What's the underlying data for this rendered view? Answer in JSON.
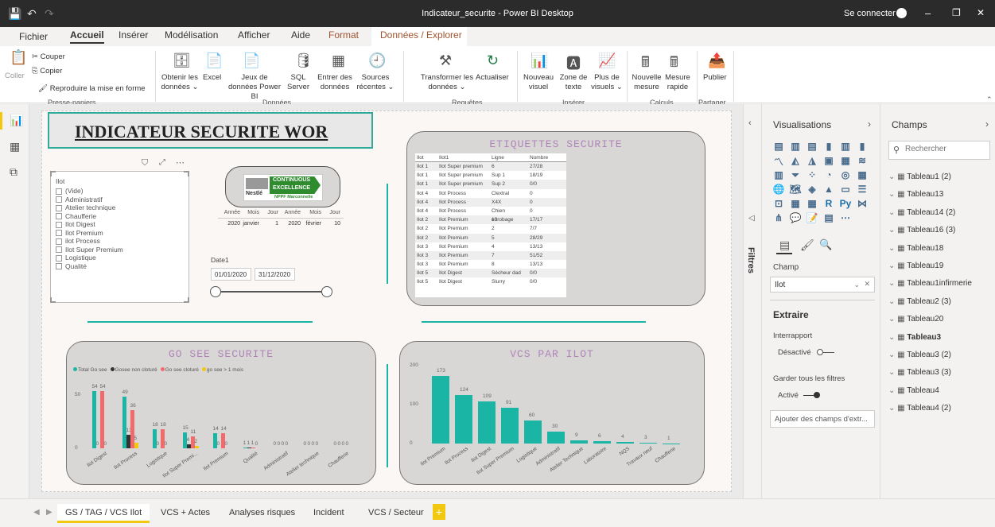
{
  "titlebar": {
    "title": "Indicateur_securite - Power BI Desktop",
    "signin": "Se connecter",
    "min": "–",
    "max": "❐",
    "close": "✕"
  },
  "menu": {
    "items": [
      "Fichier",
      "Accueil",
      "Insérer",
      "Modélisation",
      "Afficher",
      "Aide",
      "Format",
      "Données / Explorer"
    ]
  },
  "ribbon": {
    "coller": "Coller",
    "couper": "Couper",
    "copier": "Copier",
    "reproduire": "Reproduire la mise en forme",
    "presse_papiers": "Presse-papiers",
    "obtenir": "Obtenir les données ⌄",
    "excel": "Excel",
    "jeux": "Jeux de données Power BI",
    "sql": "SQL Server",
    "entrer": "Entrer des données",
    "sources": "Sources récentes ⌄",
    "donnees": "Données",
    "transformer": "Transformer les données ⌄",
    "actualiser": "Actualiser",
    "requetes": "Requêtes",
    "nouveau": "Nouveau visuel",
    "zone": "Zone de texte",
    "plus": "Plus de visuels ⌄",
    "inserer": "Insérer",
    "nouvelle_mesure": "Nouvelle mesure",
    "mesure_rapide": "Mesure rapide",
    "calculs": "Calculs",
    "publier": "Publier",
    "partager": "Partager"
  },
  "report": {
    "title": "INDICATEUR SECURITE WOR",
    "slicer": {
      "header": "Ilot",
      "items": [
        "(Vide)",
        "Administratif",
        "Atelier technique",
        "Chaufferie",
        "Ilot Digest",
        "Ilot Premium",
        "ilot Process",
        "Ilot Super Premium",
        "Logistique",
        "Qualité"
      ]
    },
    "logo": {
      "line1": "CONTINUOUS",
      "line2": "EXCELLENCE",
      "line3": "NPPF Marconnelle",
      "brand": "Nestlé"
    },
    "dates": {
      "headers": [
        "Année",
        "Mois",
        "Jour",
        "Année",
        "Mois",
        "Jour"
      ],
      "values": [
        "2020",
        "janvier",
        "1",
        "2020",
        "février",
        "10"
      ]
    },
    "date1": {
      "label": "Date1",
      "from": "01/01/2020",
      "to": "31/12/2020"
    },
    "etiquettes": {
      "title": "ETIQUETTES SECURITE",
      "headers": [
        "Ilot",
        "Ilot1",
        "Ligne",
        "Nombre"
      ],
      "rows": [
        [
          "Ilot 1",
          "Ilot Super premium",
          "6",
          "27/28"
        ],
        [
          "Ilot 1",
          "Ilot Super premium",
          "Sup 1",
          "18/19"
        ],
        [
          "Ilot 1",
          "Ilot Super premium",
          "Sup 2",
          "0/0"
        ],
        [
          "Ilot 4",
          "Ilot Process",
          "Clextral",
          "0"
        ],
        [
          "Ilot 4",
          "Ilot Process",
          "X4X",
          "0"
        ],
        [
          "Ilot 4",
          "Ilot Process",
          "Chien enrobage",
          "0"
        ],
        [
          "Ilot 2",
          "Ilot Premium",
          "10",
          "17/17"
        ],
        [
          "Ilot 2",
          "Ilot Premium",
          "2",
          "7/7"
        ],
        [
          "Ilot 2",
          "Ilot Premium",
          "5",
          "28/29"
        ],
        [
          "Ilot 3",
          "Ilot Premium",
          "4",
          "13/13"
        ],
        [
          "Ilot 3",
          "Ilot Premium",
          "7",
          "51/52"
        ],
        [
          "Ilot 3",
          "Ilot Premium",
          "8",
          "13/13"
        ],
        [
          "Ilot 5",
          "Ilot Digest",
          "Sécheur dad",
          "0/0"
        ],
        [
          "Ilot 5",
          "Ilot Digest",
          "Slurry",
          "0/0"
        ]
      ]
    }
  },
  "chart_data": [
    {
      "type": "bar",
      "title": "GO SEE SECURITE",
      "categories": [
        "Ilot Digest",
        "Ilot Process",
        "Logistique",
        "Ilot Super Premi...",
        "Ilot Premium",
        "Qualité",
        "Administratif",
        "Atelier technique",
        "Chaufferie"
      ],
      "series": [
        {
          "name": "Total Go see",
          "color": "#1bb5a5",
          "values": [
            54,
            49,
            18,
            15,
            14,
            1,
            0,
            0,
            0
          ]
        },
        {
          "name": "Gosee non cloturé",
          "color": "#333333",
          "values": [
            0,
            13,
            0,
            4,
            0,
            1,
            0,
            0,
            0
          ]
        },
        {
          "name": "Go see cloturé",
          "color": "#f06b6b",
          "values": [
            54,
            36,
            18,
            11,
            14,
            1,
            0,
            0,
            0
          ]
        },
        {
          "name": "go see > 1 mois",
          "color": "#f2c811",
          "values": [
            0,
            5,
            0,
            2,
            0,
            0,
            0,
            0,
            0
          ]
        }
      ],
      "yticks": [
        "0",
        "50"
      ],
      "ylim": [
        0,
        60
      ]
    },
    {
      "type": "bar",
      "title": "VCS PAR ILOT",
      "categories": [
        "Ilot Premium",
        "Ilot Process",
        "Ilot Digest",
        "Ilot Super Premium",
        "Logistique",
        "Administratif",
        "Atelier Technique",
        "Laboratoire",
        "NQS",
        "Travaux neuf",
        "Chaufferie"
      ],
      "values": [
        173,
        124,
        109,
        91,
        60,
        30,
        9,
        6,
        4,
        3,
        1
      ],
      "yticks": [
        "0",
        "100",
        "200"
      ],
      "ylim": [
        0,
        200
      ]
    }
  ],
  "visualisations": {
    "title": "Visualisations",
    "filtres": "Filtres",
    "champ_label": "Champ",
    "champ_value": "Ilot",
    "extraire": "Extraire",
    "interrapport": "Interrapport",
    "desactive": "Désactivé",
    "garder": "Garder tous les filtres",
    "active": "Activé",
    "ajouter": "Ajouter des champs d'extr..."
  },
  "champs": {
    "title": "Champs",
    "search_placeholder": "Rechercher",
    "items": [
      "Tableau1 (2)",
      "Tableau13",
      "Tableau14 (2)",
      "Tableau16 (3)",
      "Tableau18",
      "Tableau19",
      "Tableau1infirmerie",
      "Tableau2 (3)",
      "Tableau20",
      "Tableau3",
      "Tableau3 (2)",
      "Tableau3 (3)",
      "Tableau4",
      "Tableau4 (2)"
    ]
  },
  "tabs": {
    "items": [
      "GS / TAG / VCS Ilot",
      "VCS + Actes",
      "Analyses risques",
      "Incident",
      "VCS / Secteur"
    ],
    "add": "+"
  }
}
